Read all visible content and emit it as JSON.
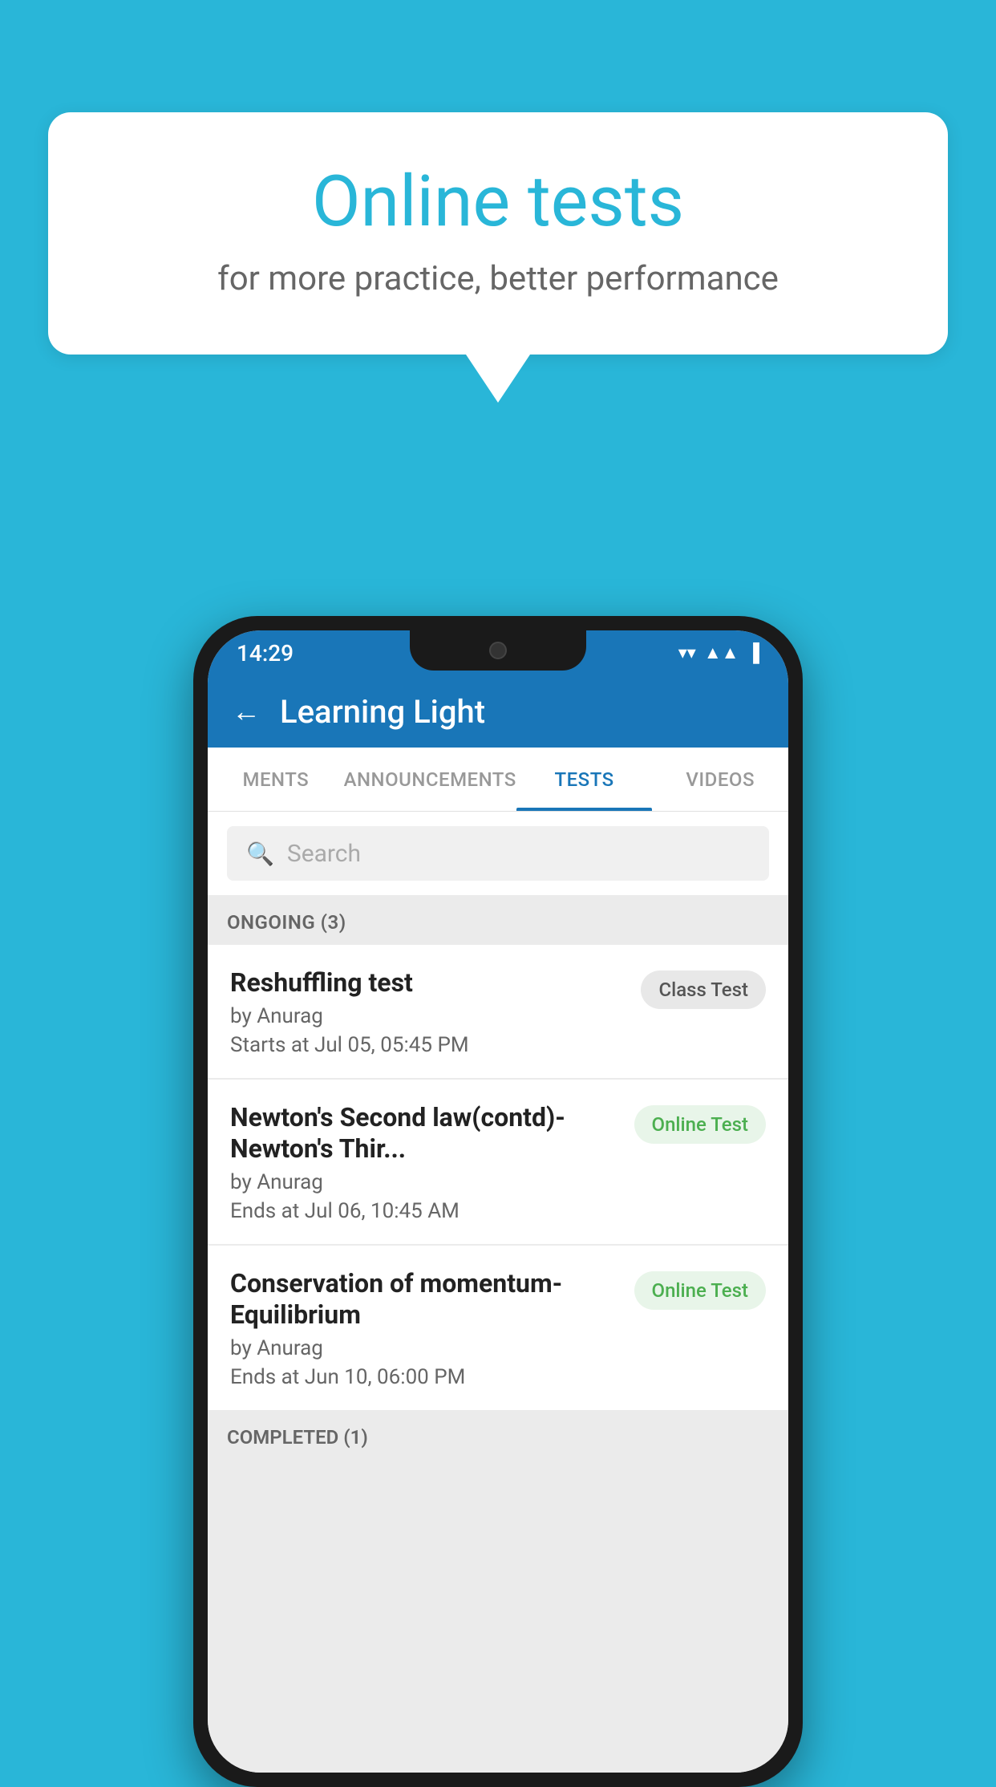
{
  "background_color": "#29b6d8",
  "speech_bubble": {
    "title": "Online tests",
    "subtitle": "for more practice, better performance"
  },
  "phone": {
    "status_bar": {
      "time": "14:29",
      "icons": [
        "wifi",
        "signal",
        "battery"
      ]
    },
    "app_bar": {
      "back_label": "←",
      "title": "Learning Light"
    },
    "tabs": [
      {
        "label": "MENTS",
        "active": false
      },
      {
        "label": "ANNOUNCEMENTS",
        "active": false
      },
      {
        "label": "TESTS",
        "active": true
      },
      {
        "label": "VIDEOS",
        "active": false
      }
    ],
    "search": {
      "placeholder": "Search"
    },
    "ongoing_section": {
      "title": "ONGOING (3)",
      "items": [
        {
          "name": "Reshuffling test",
          "author": "by Anurag",
          "date": "Starts at  Jul 05, 05:45 PM",
          "badge": "Class Test",
          "badge_type": "class"
        },
        {
          "name": "Newton's Second law(contd)-Newton's Thir...",
          "author": "by Anurag",
          "date": "Ends at  Jul 06, 10:45 AM",
          "badge": "Online Test",
          "badge_type": "online"
        },
        {
          "name": "Conservation of momentum-Equilibrium",
          "author": "by Anurag",
          "date": "Ends at  Jun 10, 06:00 PM",
          "badge": "Online Test",
          "badge_type": "online"
        }
      ]
    },
    "completed_section": {
      "title": "COMPLETED (1)"
    }
  }
}
